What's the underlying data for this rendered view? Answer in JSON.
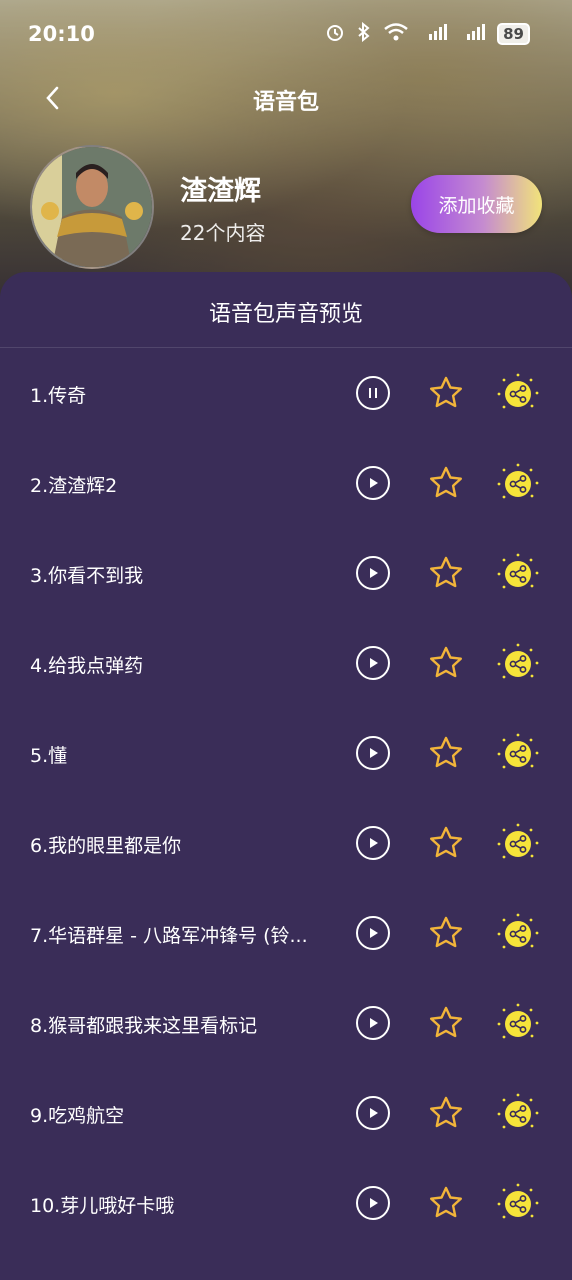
{
  "status_bar": {
    "time": "20:10",
    "battery": "89",
    "icons": [
      "alarm-icon",
      "bluetooth-icon",
      "wifi-icon",
      "signal-4g-icon",
      "signal-4g-icon"
    ]
  },
  "nav": {
    "title": "语音包",
    "back_icon": "chevron-left-icon"
  },
  "profile": {
    "name": "渣渣辉",
    "count": "22个内容",
    "favorite_label": "添加收藏"
  },
  "panel": {
    "title": "语音包声音预览"
  },
  "items": [
    {
      "title": "1.传奇",
      "state": "playing"
    },
    {
      "title": "2.渣渣辉2",
      "state": "paused"
    },
    {
      "title": "3.你看不到我",
      "state": "paused"
    },
    {
      "title": "4.给我点弹药",
      "state": "paused"
    },
    {
      "title": "5.懂",
      "state": "paused"
    },
    {
      "title": "6.我的眼里都是你",
      "state": "paused"
    },
    {
      "title": "7.华语群星 - 八路军冲锋号 (铃...",
      "state": "paused"
    },
    {
      "title": "8.猴哥都跟我来这里看标记",
      "state": "paused"
    },
    {
      "title": "9.吃鸡航空",
      "state": "paused"
    },
    {
      "title": "10.芽儿哦好卡哦",
      "state": "paused"
    }
  ],
  "colors": {
    "panel_bg": "#3a2d58",
    "star": "#f2b53a",
    "share_bg": "#f6e43a",
    "button_gradient": [
      "#9a45e8",
      "#f1e37a"
    ]
  }
}
